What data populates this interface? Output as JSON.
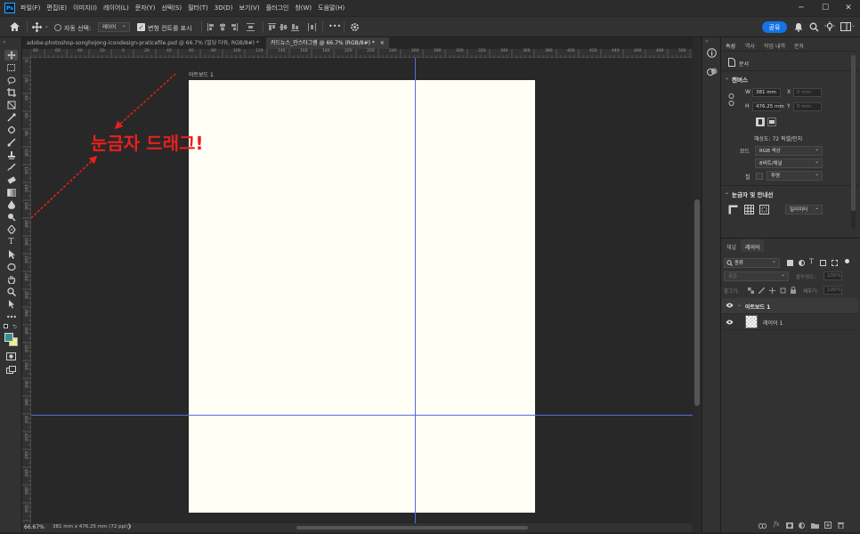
{
  "app": {
    "logo": "Ps"
  },
  "menu": [
    "파일(F)",
    "편집(E)",
    "이미지(I)",
    "레이어(L)",
    "문자(Y)",
    "선택(S)",
    "필터(T)",
    "3D(D)",
    "보기(V)",
    "플러그인",
    "창(W)",
    "도움말(H)"
  ],
  "window_controls": {
    "minimize": "─",
    "maximize": "☐",
    "close": "✕"
  },
  "options": {
    "auto_select_label": "자동 선택:",
    "auto_select_value": "레이어",
    "transform_label": "변형 컨트롤 표시",
    "more": "•••",
    "share_label": "공유"
  },
  "tabs": [
    {
      "label": "adobe-photoshop-songhojong-icondesign-praticefile.psd @ 66.7% (빌딩 타워, RGB/8#) *",
      "close": "×"
    },
    {
      "label": "카드뉴스_인스타그램 @ 66.7% (RGB/8#) *",
      "close": "×"
    }
  ],
  "ruler_top_numbers": [
    "80",
    "60",
    "40",
    "20",
    "0",
    "20",
    "40",
    "60",
    "80",
    "100",
    "120",
    "140",
    "160",
    "180",
    "200",
    "220",
    "240",
    "260",
    "280",
    "300",
    "320",
    "340",
    "360",
    "380",
    "400",
    "420",
    "440",
    "460",
    "480",
    "500",
    "520",
    "540"
  ],
  "ruler_left_numbers": [
    "0",
    "20",
    "40",
    "60",
    "80",
    "100",
    "120",
    "140",
    "160",
    "180",
    "200",
    "220",
    "240",
    "260",
    "280",
    "300",
    "320",
    "340",
    "360",
    "380",
    "400",
    "420",
    "440",
    "460",
    "480",
    "500"
  ],
  "artboard": {
    "label": "아트보드 1",
    "color": "#fffff6"
  },
  "annotation": {
    "text": "눈금자 드래그!",
    "color": "#e8201c"
  },
  "guides_color": "#4f6ee8",
  "status": {
    "zoom": "66.67%",
    "doc_info": "381 mm x 476.25 mm (72 ppi)",
    "arrow": "❯"
  },
  "properties": {
    "tabs": [
      "속성",
      "역사",
      "작업 내역",
      "문자"
    ],
    "doc_label": "문서",
    "canvas_title": "캔버스",
    "w_label": "W",
    "w_value": "381 mm",
    "h_label": "H",
    "h_value": "476.25 mm",
    "x_label": "X",
    "x_placeholder": "0 mm",
    "y_label": "Y",
    "y_placeholder": "0 mm",
    "resolution": "해상도: 72 픽셀/인치",
    "mode_label": "모드",
    "mode_value": "RGB 색상",
    "bit_value": "8비트/채널",
    "fill_label": "칠",
    "fill_value": "투명",
    "rulers_title": "눈금자 및 안내선",
    "unit_value": "밀리미터"
  },
  "layers_panel": {
    "tabs": [
      "채널",
      "레이어"
    ],
    "kind_label": "종류",
    "blend_value": "표준",
    "opacity_label": "불투명도:",
    "opacity_value": "100%",
    "lock_label": "잠그기:",
    "fill_label": "채우기:",
    "fill_value": "100%",
    "rows": [
      {
        "name": "아트보드 1"
      },
      {
        "name": "레이어 1"
      }
    ]
  }
}
